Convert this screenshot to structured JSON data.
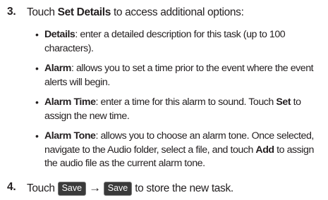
{
  "step3": {
    "number": "3.",
    "pre": "Touch ",
    "bold": "Set Details",
    "post": " to access additional options:"
  },
  "bullets": [
    {
      "term": "Details",
      "line1": ": enter a detailed description for this task (up to 100",
      "line2": "characters)."
    },
    {
      "term": "Alarm",
      "line1": ": allows you to set a time prior to the event where the event",
      "line2": "alerts will begin."
    },
    {
      "term": "Alarm Time",
      "line1a": ": enter a time for this alarm to sound. Touch ",
      "line1b": "Set",
      "line1c": " to",
      "line2": "assign the new time."
    },
    {
      "term": "Alarm Tone",
      "line1": ": allows you to choose an alarm tone. Once selected,",
      "line2": "navigate to the Audio folder, select a file, and touch ",
      "line2b": "Add",
      "line2c": " to assign",
      "line3": "the audio file as the current alarm tone."
    }
  ],
  "step4": {
    "number": "4.",
    "pre": "Touch ",
    "button1": "Save",
    "arrow": "→",
    "button2": "Save",
    "post": " to store the new task."
  }
}
